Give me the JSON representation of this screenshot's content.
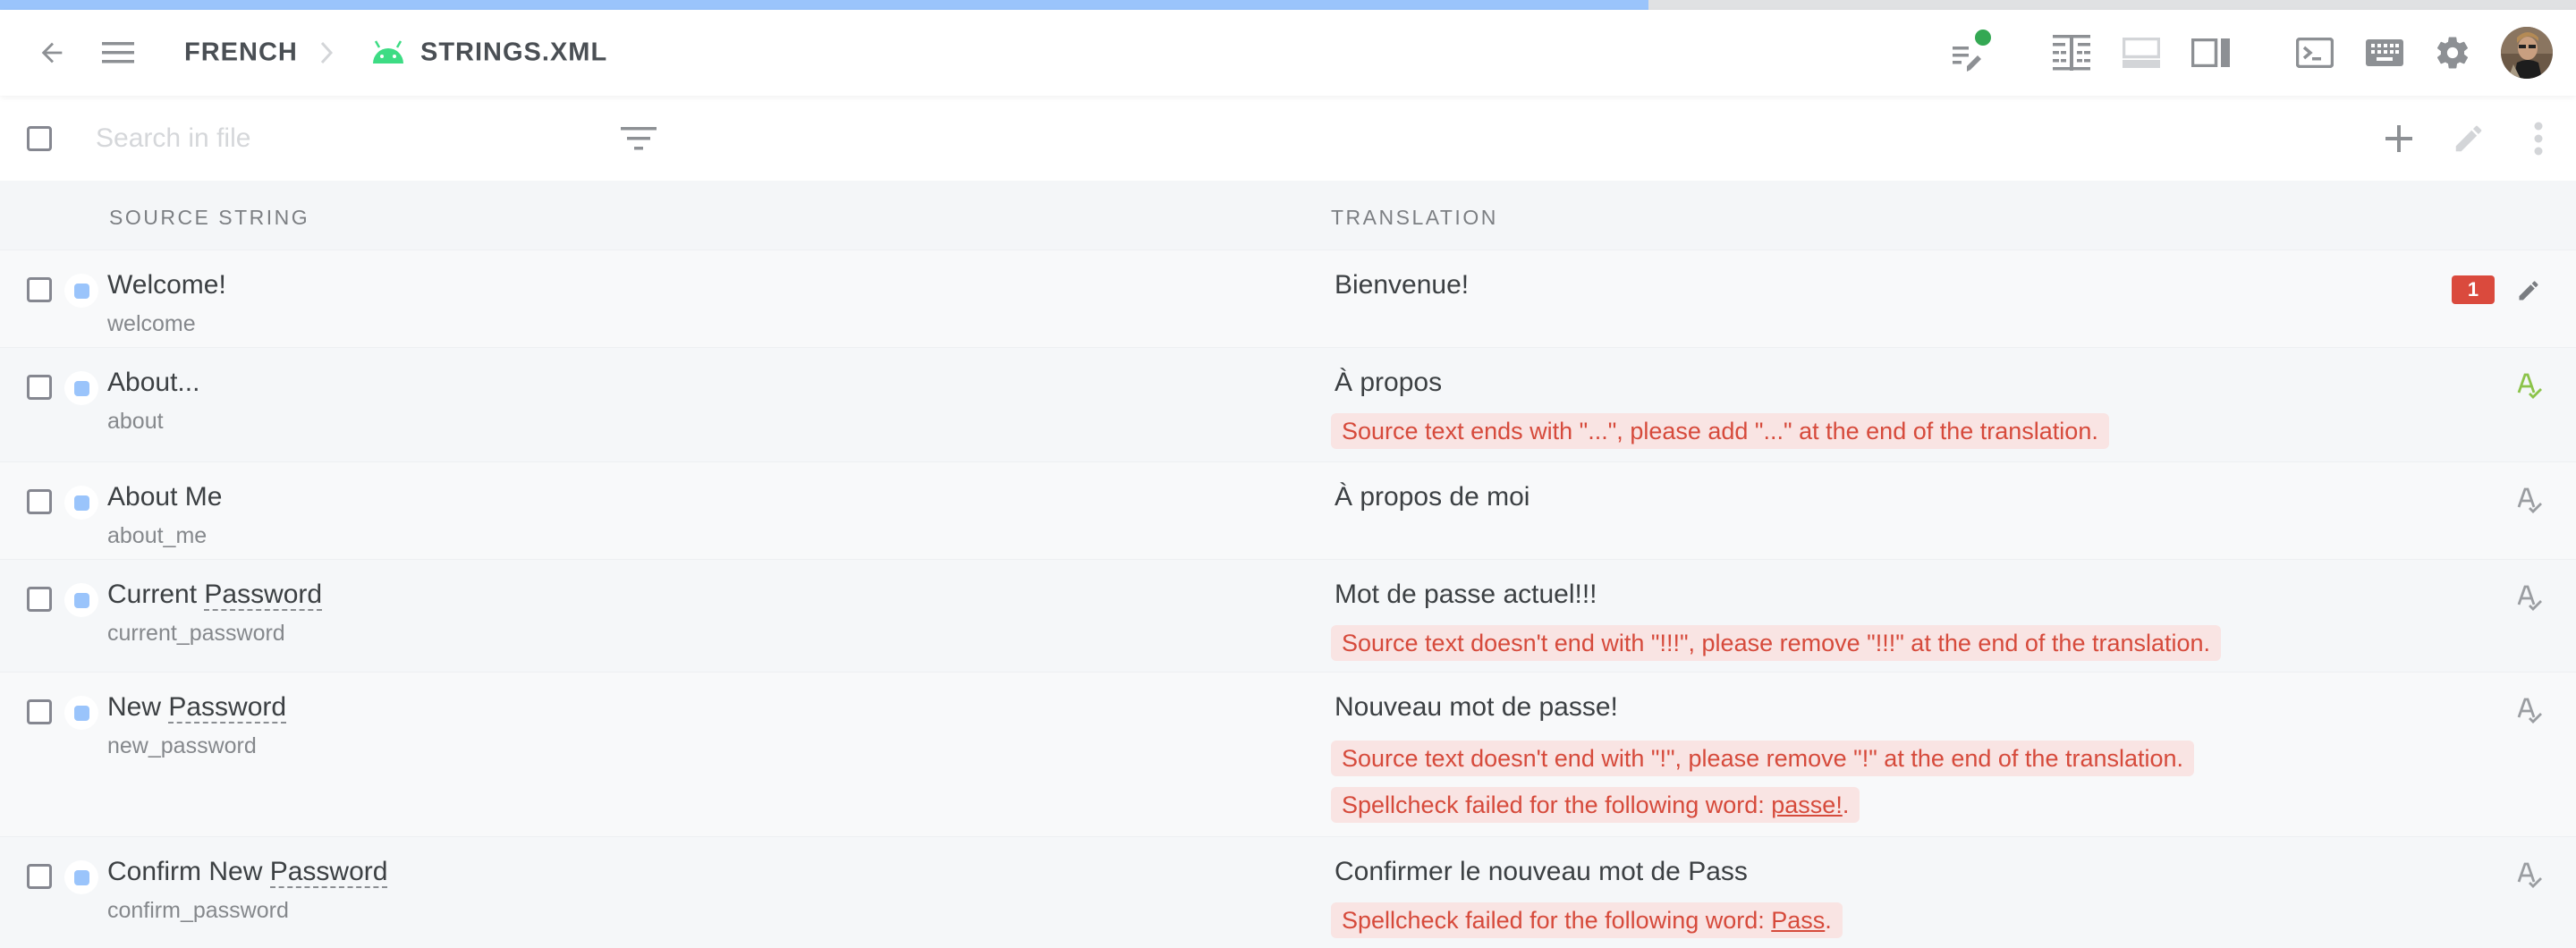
{
  "progress": {
    "fraction": 0.64,
    "color": "#9ac4fb"
  },
  "header": {
    "back_icon": "arrow-left-icon",
    "menu_icon": "hamburger-menu-icon",
    "breadcrumb": [
      {
        "label": "FRENCH"
      },
      {
        "label": "STRINGS.XML",
        "icon": "android-icon",
        "icon_color": "#3ddc84"
      }
    ],
    "separator_icon": "chevron-right-icon",
    "toolbar_icons": [
      {
        "name": "proofread-mode-icon",
        "status_dot_color": "#34a853"
      },
      {
        "name": "side-by-side-view-icon"
      },
      {
        "name": "bottom-panel-icon",
        "disabled": true
      },
      {
        "name": "right-panel-icon"
      },
      {
        "name": "terminal-icon"
      },
      {
        "name": "keyboard-shortcuts-icon"
      },
      {
        "name": "settings-gear-icon"
      },
      {
        "name": "user-avatar"
      }
    ]
  },
  "search": {
    "placeholder": "Search in file",
    "value": "",
    "filter_icon": "filter-icon",
    "actions": [
      "add-string-icon",
      "edit-pencil-icon",
      "more-vert-icon"
    ]
  },
  "columns": {
    "source": "SOURCE STRING",
    "translation": "TRANSLATION"
  },
  "rows": [
    {
      "source_before": "Welcome!",
      "source_term": "",
      "source_after": "",
      "key": "welcome",
      "translation": "Bienvenue!",
      "errors": [],
      "badge": "1",
      "action_icon": "edit-pencil-icon"
    },
    {
      "source_before": "About...",
      "source_term": "",
      "source_after": "",
      "key": "about",
      "translation": "À propos",
      "errors": [
        {
          "text": "Source text ends with \"...\", please add \"...\" at the end of the translation.",
          "word": ""
        }
      ],
      "action_icon": "spellcheck-icon",
      "action_color": "#8bc34a"
    },
    {
      "source_before": "About Me",
      "source_term": "",
      "source_after": "",
      "key": "about_me",
      "translation": "À propos de moi",
      "errors": [],
      "action_icon": "spellcheck-icon",
      "action_color": "#9a9da1"
    },
    {
      "source_before": "Current ",
      "source_term": "Password",
      "source_after": "",
      "key": "current_password",
      "translation": "Mot de passe actuel!!!",
      "errors": [
        {
          "text": "Source text doesn't end with \"!!!\", please remove \"!!!\" at the end of the translation.",
          "word": ""
        }
      ],
      "action_icon": "spellcheck-icon",
      "action_color": "#9a9da1"
    },
    {
      "source_before": "New ",
      "source_term": "Password",
      "source_after": "",
      "key": "new_password",
      "translation": "Nouveau mot de passe!",
      "errors": [
        {
          "text": "Source text doesn't end with \"!\", please remove \"!\" at the end of the translation.",
          "word": ""
        },
        {
          "text": "Spellcheck failed for the following word: ",
          "word": "passe!",
          "suffix": "."
        }
      ],
      "action_icon": "spellcheck-icon",
      "action_color": "#9a9da1"
    },
    {
      "source_before": "Confirm New ",
      "source_term": "Password",
      "source_after": "",
      "key": "confirm_password",
      "translation": "Confirmer le nouveau mot de Pass",
      "errors": [
        {
          "text": "Spellcheck failed for the following word: ",
          "word": "Pass",
          "suffix": "."
        }
      ],
      "action_icon": "spellcheck-icon",
      "action_color": "#9a9da1"
    }
  ]
}
